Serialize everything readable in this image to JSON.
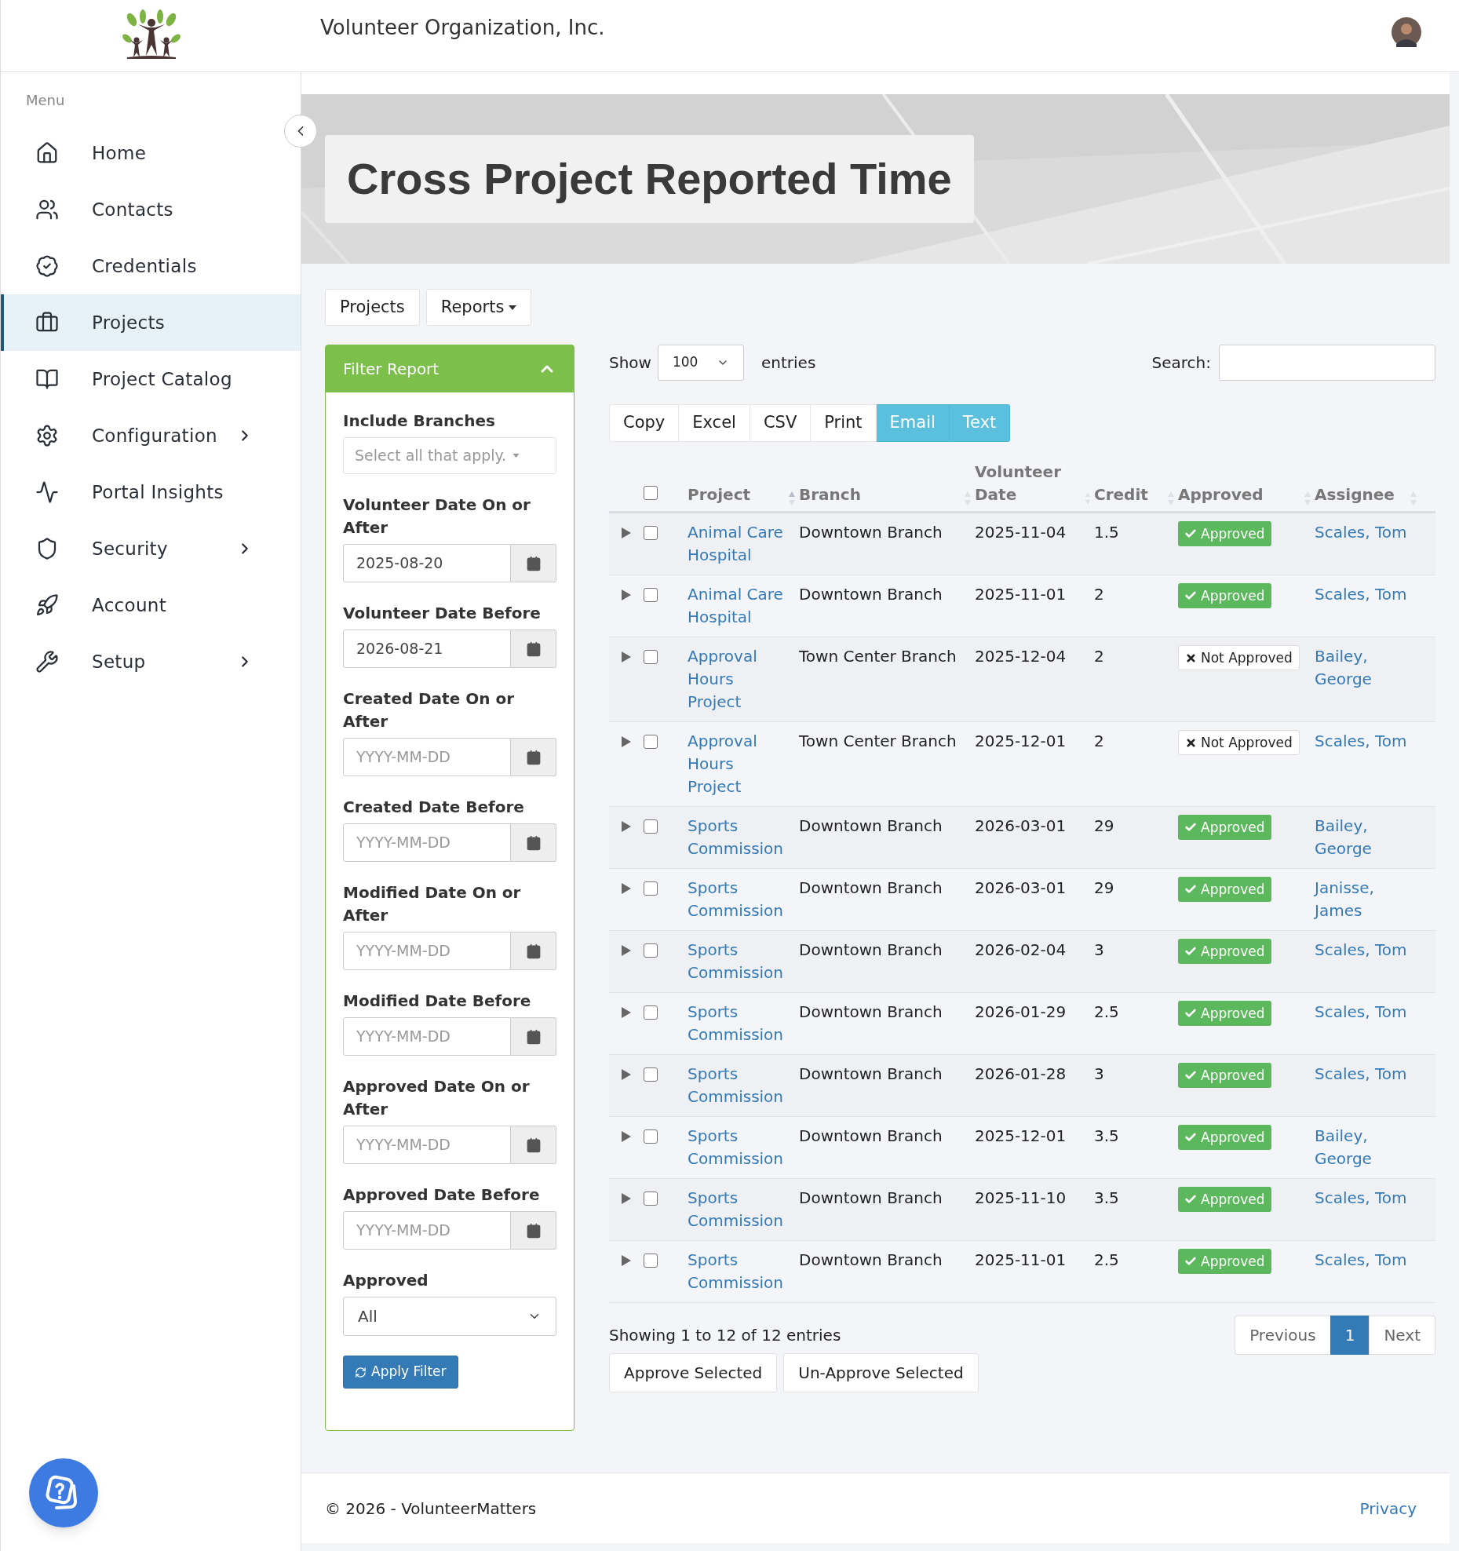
{
  "header": {
    "org_name": "Volunteer Organization, Inc."
  },
  "sidebar": {
    "heading": "Menu",
    "items": [
      {
        "label": "Home",
        "selected": false,
        "expandable": false
      },
      {
        "label": "Contacts",
        "selected": false,
        "expandable": false
      },
      {
        "label": "Credentials",
        "selected": false,
        "expandable": false
      },
      {
        "label": "Projects",
        "selected": true,
        "expandable": false
      },
      {
        "label": "Project Catalog",
        "selected": false,
        "expandable": false
      },
      {
        "label": "Configuration",
        "selected": false,
        "expandable": true
      },
      {
        "label": "Portal Insights",
        "selected": false,
        "expandable": false
      },
      {
        "label": "Security",
        "selected": false,
        "expandable": true
      },
      {
        "label": "Account",
        "selected": false,
        "expandable": false
      },
      {
        "label": "Setup",
        "selected": false,
        "expandable": true
      }
    ]
  },
  "page_title": "Cross Project Reported Time",
  "nav_tabs": [
    {
      "label": "Projects",
      "dropdown": false
    },
    {
      "label": "Reports",
      "dropdown": true
    }
  ],
  "filter": {
    "title": "Filter Report",
    "expanded": true,
    "fields": [
      {
        "kind": "multiselect",
        "label": "Include Branches",
        "placeholder": "Select all that apply."
      },
      {
        "kind": "date",
        "label": "Volunteer Date On or After",
        "value": "2025-08-20"
      },
      {
        "kind": "date",
        "label": "Volunteer Date Before",
        "value": "2026-08-21"
      },
      {
        "kind": "date",
        "label": "Created Date On or After",
        "placeholder": "YYYY-MM-DD"
      },
      {
        "kind": "date",
        "label": "Created Date Before",
        "placeholder": "YYYY-MM-DD"
      },
      {
        "kind": "date",
        "label": "Modified Date On or After",
        "placeholder": "YYYY-MM-DD"
      },
      {
        "kind": "date",
        "label": "Modified Date Before",
        "placeholder": "YYYY-MM-DD"
      },
      {
        "kind": "date",
        "label": "Approved Date On or After",
        "placeholder": "YYYY-MM-DD"
      },
      {
        "kind": "date",
        "label": "Approved Date Before",
        "placeholder": "YYYY-MM-DD"
      },
      {
        "kind": "select",
        "label": "Approved",
        "value": "All"
      }
    ],
    "apply_button": "Apply Filter"
  },
  "table_controls": {
    "show_label": "Show",
    "page_size": "100",
    "entries_label": "entries",
    "search_label": "Search:"
  },
  "export_buttons": [
    {
      "label": "Copy",
      "highlighted": false
    },
    {
      "label": "Excel",
      "highlighted": false
    },
    {
      "label": "CSV",
      "highlighted": false
    },
    {
      "label": "Print",
      "highlighted": false
    },
    {
      "label": "Email",
      "highlighted": true
    },
    {
      "label": "Text",
      "highlighted": true
    }
  ],
  "table": {
    "select_all_checked": false,
    "columns": [
      "Project",
      "Branch",
      "Volunteer Date",
      "Credit",
      "Approved",
      "Assignee"
    ],
    "rows": [
      {
        "project": "Animal Care Hospital",
        "branch": "Downtown Branch",
        "date": "2025-11-04",
        "credit": "1.5",
        "approved": true,
        "status": "Approved",
        "assignee": "Scales, Tom",
        "checked": false
      },
      {
        "project": "Animal Care Hospital",
        "branch": "Downtown Branch",
        "date": "2025-11-01",
        "credit": "2",
        "approved": true,
        "status": "Approved",
        "assignee": "Scales, Tom",
        "checked": false
      },
      {
        "project": "Approval Hours Project",
        "branch": "Town Center Branch",
        "date": "2025-12-04",
        "credit": "2",
        "approved": false,
        "status": "Not Approved",
        "assignee": "Bailey, George",
        "checked": false
      },
      {
        "project": "Approval Hours Project",
        "branch": "Town Center Branch",
        "date": "2025-12-01",
        "credit": "2",
        "approved": false,
        "status": "Not Approved",
        "assignee": "Scales, Tom",
        "checked": false
      },
      {
        "project": "Sports Commission",
        "branch": "Downtown Branch",
        "date": "2026-03-01",
        "credit": "29",
        "approved": true,
        "status": "Approved",
        "assignee": "Bailey, George",
        "checked": false
      },
      {
        "project": "Sports Commission",
        "branch": "Downtown Branch",
        "date": "2026-03-01",
        "credit": "29",
        "approved": true,
        "status": "Approved",
        "assignee": "Janisse, James",
        "checked": false
      },
      {
        "project": "Sports Commission",
        "branch": "Downtown Branch",
        "date": "2026-02-04",
        "credit": "3",
        "approved": true,
        "status": "Approved",
        "assignee": "Scales, Tom",
        "checked": false
      },
      {
        "project": "Sports Commission",
        "branch": "Downtown Branch",
        "date": "2026-01-29",
        "credit": "2.5",
        "approved": true,
        "status": "Approved",
        "assignee": "Scales, Tom",
        "checked": false
      },
      {
        "project": "Sports Commission",
        "branch": "Downtown Branch",
        "date": "2026-01-28",
        "credit": "3",
        "approved": true,
        "status": "Approved",
        "assignee": "Scales, Tom",
        "checked": false
      },
      {
        "project": "Sports Commission",
        "branch": "Downtown Branch",
        "date": "2025-12-01",
        "credit": "3.5",
        "approved": true,
        "status": "Approved",
        "assignee": "Bailey, George",
        "checked": false
      },
      {
        "project": "Sports Commission",
        "branch": "Downtown Branch",
        "date": "2025-11-10",
        "credit": "3.5",
        "approved": true,
        "status": "Approved",
        "assignee": "Scales, Tom",
        "checked": false
      },
      {
        "project": "Sports Commission",
        "branch": "Downtown Branch",
        "date": "2025-11-01",
        "credit": "2.5",
        "approved": true,
        "status": "Approved",
        "assignee": "Scales, Tom",
        "checked": false
      }
    ]
  },
  "table_info": "Showing 1 to 12 of 12 entries",
  "pagination": [
    {
      "label": "Previous",
      "selected": false
    },
    {
      "label": "1",
      "selected": true
    },
    {
      "label": "Next",
      "selected": false
    }
  ],
  "bulk_actions": [
    "Approve Selected",
    "Un-Approve Selected"
  ],
  "footer": {
    "copyright": "© 2026 - VolunteerMatters",
    "privacy_link": "Privacy"
  }
}
